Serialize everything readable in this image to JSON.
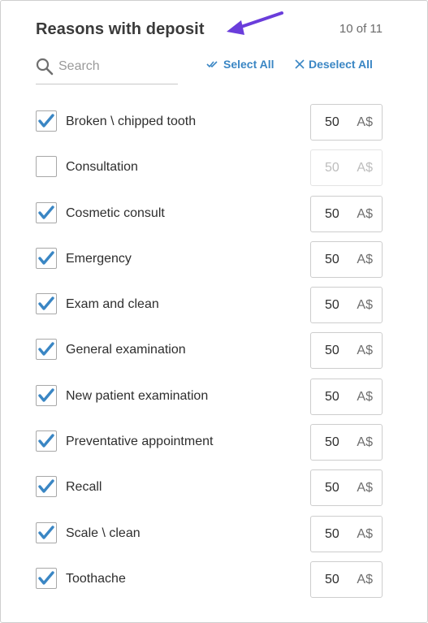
{
  "header": {
    "title": "Reasons with deposit",
    "count": "10 of 11"
  },
  "search": {
    "placeholder": "Search",
    "value": ""
  },
  "actions": {
    "select_all": "Select All",
    "deselect_all": "Deselect All"
  },
  "colors": {
    "accent": "#3a86c4",
    "annotation_arrow": "#6a3ddb"
  },
  "reasons": [
    {
      "label": "Broken \\ chipped tooth",
      "checked": true,
      "amount": "50",
      "currency": "A$"
    },
    {
      "label": "Consultation",
      "checked": false,
      "amount": "50",
      "currency": "A$"
    },
    {
      "label": "Cosmetic consult",
      "checked": true,
      "amount": "50",
      "currency": "A$"
    },
    {
      "label": "Emergency",
      "checked": true,
      "amount": "50",
      "currency": "A$"
    },
    {
      "label": "Exam and clean",
      "checked": true,
      "amount": "50",
      "currency": "A$"
    },
    {
      "label": "General examination",
      "checked": true,
      "amount": "50",
      "currency": "A$"
    },
    {
      "label": "New patient examination",
      "checked": true,
      "amount": "50",
      "currency": "A$"
    },
    {
      "label": "Preventative appointment",
      "checked": true,
      "amount": "50",
      "currency": "A$"
    },
    {
      "label": "Recall",
      "checked": true,
      "amount": "50",
      "currency": "A$"
    },
    {
      "label": "Scale \\ clean",
      "checked": true,
      "amount": "50",
      "currency": "A$"
    },
    {
      "label": "Toothache",
      "checked": true,
      "amount": "50",
      "currency": "A$"
    }
  ]
}
